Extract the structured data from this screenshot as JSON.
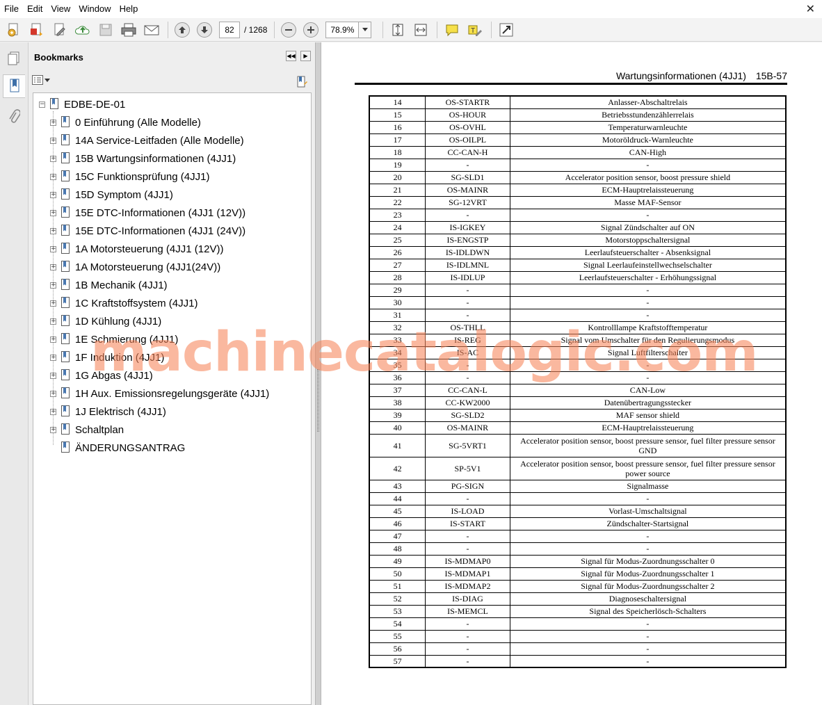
{
  "menu": [
    "File",
    "Edit",
    "View",
    "Window",
    "Help"
  ],
  "toolbar": {
    "page_current": "82",
    "page_total": "/ 1268",
    "zoom": "78.9%",
    "icons": [
      "create-pdf-icon",
      "convert-icon",
      "edit-icon",
      "upload-cloud-icon",
      "save-icon",
      "print-icon",
      "email-icon",
      "page-up-icon",
      "page-down-icon",
      "zoom-out-icon",
      "zoom-in-icon",
      "fit-page-icon",
      "fit-width-icon",
      "comment-icon",
      "highlight-icon",
      "fullscreen-icon"
    ]
  },
  "sidebar": {
    "title": "Bookmarks",
    "root": "EDBE-DE-01",
    "items": [
      "0 Einführung (Alle Modelle)",
      "14A Service-Leitfaden (Alle Modelle)",
      "15B Wartungsinformationen (4JJ1)",
      "15C Funktionsprüfung (4JJ1)",
      "15D Symptom (4JJ1)",
      "15E DTC-Informationen (4JJ1 (12V))",
      "15E DTC-Informationen (4JJ1 (24V))",
      "1A Motorsteuerung (4JJ1 (12V))",
      "1A Motorsteuerung (4JJ1(24V))",
      "1B Mechanik (4JJ1)",
      "1C Kraftstoffsystem (4JJ1)",
      "1D Kühlung (4JJ1)",
      "1E Schmierung (4JJ1)",
      "1F Induktion (4JJ1)",
      "1G Abgas (4JJ1)",
      "1H Aux. Emissionsregelungsgeräte (4JJ1)",
      "1J Elektrisch (4JJ1)",
      "Schaltplan",
      "ÄNDERUNGSANTRAG"
    ]
  },
  "document": {
    "header_title": "Wartungsinformationen (4JJ1)",
    "page_label": "15B-57",
    "rows": [
      [
        "14",
        "OS-STARTR",
        "Anlasser-Abschaltrelais"
      ],
      [
        "15",
        "OS-HOUR",
        "Betriebsstundenzählerrelais"
      ],
      [
        "16",
        "OS-OVHL",
        "Temperaturwarnleuchte"
      ],
      [
        "17",
        "OS-OILPL",
        "Motoröldruck-Warnleuchte"
      ],
      [
        "18",
        "CC-CAN-H",
        "CAN-High"
      ],
      [
        "19",
        "-",
        "-"
      ],
      [
        "20",
        "SG-SLD1",
        "Accelerator position sensor, boost pressure shield"
      ],
      [
        "21",
        "OS-MAINR",
        "ECM-Hauptrelaissteuerung"
      ],
      [
        "22",
        "SG-12VRT",
        "Masse MAF-Sensor"
      ],
      [
        "23",
        "-",
        "-"
      ],
      [
        "24",
        "IS-IGKEY",
        "Signal Zündschalter auf ON"
      ],
      [
        "25",
        "IS-ENGSTP",
        "Motorstoppschaltersignal"
      ],
      [
        "26",
        "IS-IDLDWN",
        "Leerlaufsteuerschalter - Absenksignal"
      ],
      [
        "27",
        "IS-IDLMNL",
        "Signal Leerlaufeinstellwechselschalter"
      ],
      [
        "28",
        "IS-IDLUP",
        "Leerlaufsteuerschalter - Erhöhungssignal"
      ],
      [
        "29",
        "-",
        "-"
      ],
      [
        "30",
        "-",
        "-"
      ],
      [
        "31",
        "-",
        "-"
      ],
      [
        "32",
        "OS-THLL",
        "Kontrolllampe Kraftstofftemperatur"
      ],
      [
        "33",
        "IS-REG",
        "Signal vom Umschalter für den Regulierungsmodus"
      ],
      [
        "34",
        "IS-AC",
        "Signal Luftfilterschalter"
      ],
      [
        "35",
        "-",
        "-"
      ],
      [
        "36",
        "-",
        "-"
      ],
      [
        "37",
        "CC-CAN-L",
        "CAN-Low"
      ],
      [
        "38",
        "CC-KW2000",
        "Datenübertragungsstecker"
      ],
      [
        "39",
        "SG-SLD2",
        "MAF sensor shield"
      ],
      [
        "40",
        "OS-MAINR",
        "ECM-Hauptrelaissteuerung"
      ],
      [
        "41",
        "SG-5VRT1",
        "Accelerator position sensor, boost pressure sensor, fuel filter pressure sensor GND"
      ],
      [
        "42",
        "SP-5V1",
        "Accelerator position sensor, boost pressure sensor, fuel filter pressure sensor power source"
      ],
      [
        "43",
        "PG-SIGN",
        "Signalmasse"
      ],
      [
        "44",
        "-",
        "-"
      ],
      [
        "45",
        "IS-LOAD",
        "Vorlast-Umschaltsignal"
      ],
      [
        "46",
        "IS-START",
        "Zündschalter-Startsignal"
      ],
      [
        "47",
        "-",
        "-"
      ],
      [
        "48",
        "-",
        "-"
      ],
      [
        "49",
        "IS-MDMAP0",
        "Signal für Modus-Zuordnungsschalter 0"
      ],
      [
        "50",
        "IS-MDMAP1",
        "Signal für Modus-Zuordnungsschalter 1"
      ],
      [
        "51",
        "IS-MDMAP2",
        "Signal für Modus-Zuordnungsschalter 2"
      ],
      [
        "52",
        "IS-DIAG",
        "Diagnoseschaltersignal"
      ],
      [
        "53",
        "IS-MEMCL",
        "Signal des Speicherlösch-Schalters"
      ],
      [
        "54",
        "-",
        "-"
      ],
      [
        "55",
        "-",
        "-"
      ],
      [
        "56",
        "-",
        "-"
      ],
      [
        "57",
        "-",
        "-"
      ]
    ]
  },
  "watermark": "machinecatalogic.com"
}
